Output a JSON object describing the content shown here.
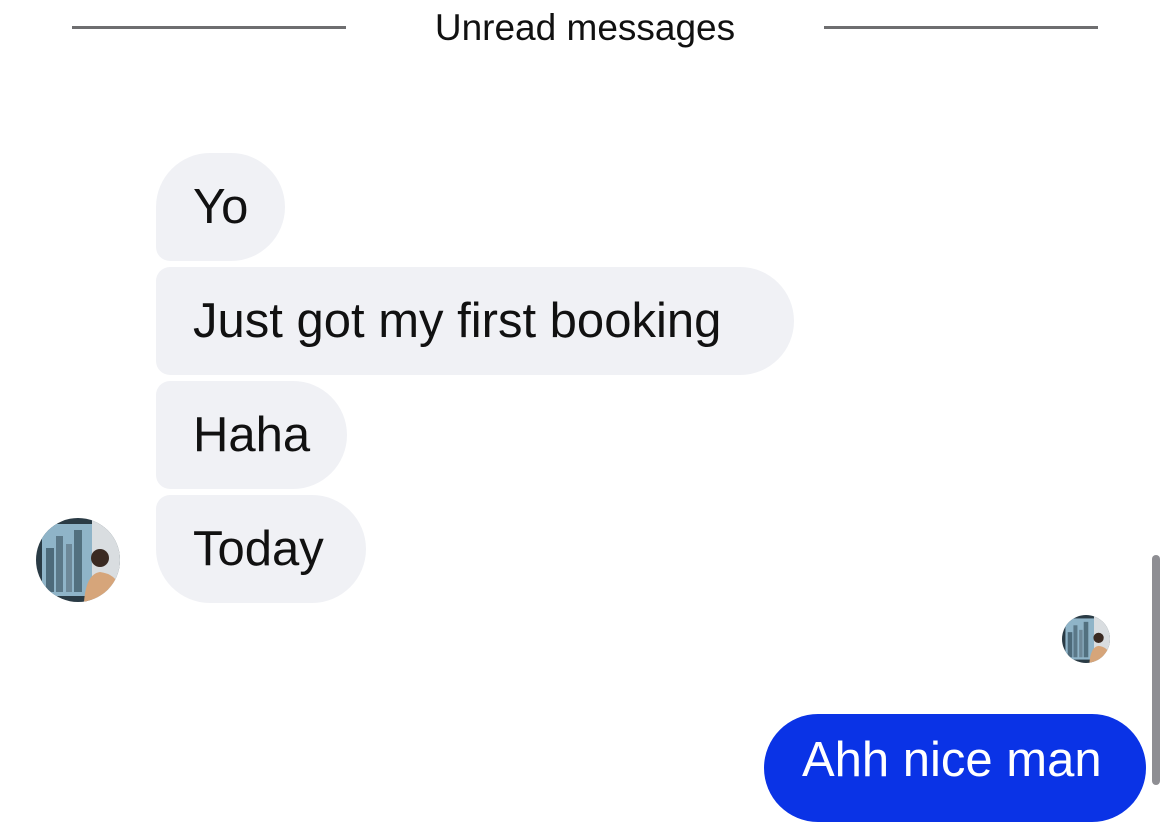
{
  "divider": {
    "label": "Unread messages"
  },
  "incoming_messages": [
    {
      "text": "Yo"
    },
    {
      "text": "Just got my first booking"
    },
    {
      "text": "Haha"
    },
    {
      "text": "Today"
    }
  ],
  "outgoing_messages": [
    {
      "text": "Ahh nice man"
    }
  ],
  "colors": {
    "incoming_bubble": "#f0f1f5",
    "outgoing_bubble": "#0a33e6",
    "divider_line": "#6e6e70",
    "scrollbar": "#8e8e93"
  },
  "icons": {
    "sender_avatar": "profile-photo",
    "read_receipt_avatar": "profile-photo"
  }
}
